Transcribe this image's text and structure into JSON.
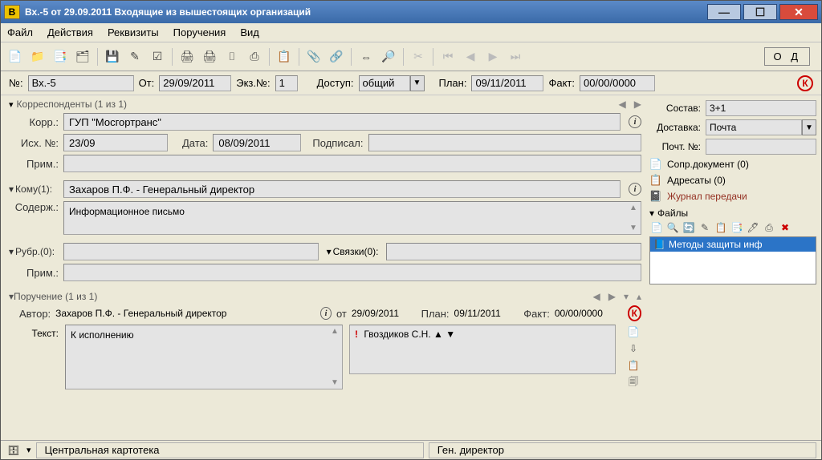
{
  "window": {
    "title": "Вх.-5 от 29.09.2011 Входящие из вышестоящих организаций",
    "app_icon_letter": "В"
  },
  "menu": {
    "file": "Файл",
    "actions": "Действия",
    "details": "Реквизиты",
    "orders": "Поручения",
    "view": "Вид"
  },
  "od_box": "О Д",
  "summary": {
    "num_label": "№:",
    "num": "Вх.-5",
    "from_label": "От:",
    "from": "29/09/2011",
    "copy_label": "Экз.№:",
    "copy": "1",
    "access_label": "Доступ:",
    "access": "общий",
    "plan_label": "План:",
    "plan": "09/11/2011",
    "fact_label": "Факт:",
    "fact": "00/00/0000",
    "k_badge": "К"
  },
  "correspondents": {
    "header": "Корреспонденты (1 из 1)",
    "corr_label": "Корр.:",
    "corr": "ГУП \"Мосгортранс\"",
    "out_label": "Исх. №:",
    "out": "23/09",
    "date_label": "Дата:",
    "date": "08/09/2011",
    "signed_label": "Подписал:",
    "signed": "",
    "note_label": "Прим.:",
    "note": ""
  },
  "to": {
    "header": "Кому(1):",
    "value": "Захаров П.Ф. - Генеральный директор",
    "content_label": "Содерж.:",
    "content": "Информационное письмо"
  },
  "rubr": {
    "header": "Рубр.(0):",
    "links_label": "Связки(0):",
    "note_label": "Прим.:",
    "value": "",
    "note": ""
  },
  "right": {
    "composition_label": "Состав:",
    "composition": "3+1",
    "delivery_label": "Доставка:",
    "delivery": "Почта",
    "post_label": "Почт. №:",
    "post": "",
    "accomp_doc": "Сопр.документ (0)",
    "addressees": "Адресаты (0)",
    "transfer_log": "Журнал передачи",
    "files_header": "Файлы",
    "file_item": "Методы защиты инф"
  },
  "order": {
    "header": "Поручение (1 из 1)",
    "author_label": "Автор:",
    "author": "Захаров П.Ф. - Генеральный директор",
    "from_label": "от",
    "from": "29/09/2011",
    "plan_label": "План:",
    "plan": "09/11/2011",
    "fact_label": "Факт:",
    "fact": "00/00/0000",
    "text_label": "Текст:",
    "text": "К исполнению",
    "executor": "Гвоздиков С.Н.",
    "k_badge": "К"
  },
  "status": {
    "cabinet": "Центральная картотека",
    "role": "Ген. директор"
  }
}
